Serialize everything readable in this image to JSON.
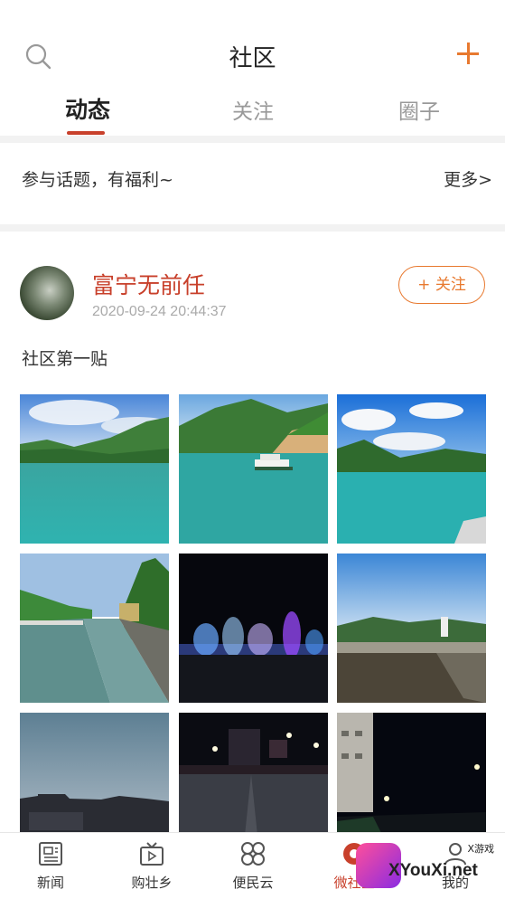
{
  "header": {
    "title": "社区",
    "search_icon": "search-icon",
    "add_icon": "plus-icon",
    "accent": "#e8792f"
  },
  "tabs": [
    {
      "label": "动态",
      "active": true
    },
    {
      "label": "关注",
      "active": false
    },
    {
      "label": "圈子",
      "active": false
    }
  ],
  "topic": {
    "text": "参与话题，有福利~",
    "more": "更多>"
  },
  "post": {
    "author": "富宁无前任",
    "time": "2020-09-24 20:44:37",
    "follow_label": "+ 关注",
    "content": "社区第一贴",
    "photo_count": 9
  },
  "bottom_nav": [
    {
      "label": "新闻",
      "icon": "news-icon"
    },
    {
      "label": "购壮乡",
      "icon": "tv-icon"
    },
    {
      "label": "便民云",
      "icon": "grid-icon"
    },
    {
      "label": "微社区",
      "icon": "community-icon",
      "active": true
    },
    {
      "label": "我的",
      "icon": "user-icon"
    }
  ],
  "watermark": {
    "text": "XYouXi.net",
    "small": "X游戏"
  },
  "colors": {
    "brand_red": "#c8402b",
    "orange": "#e8792f",
    "divider": "#f2f2f2"
  }
}
